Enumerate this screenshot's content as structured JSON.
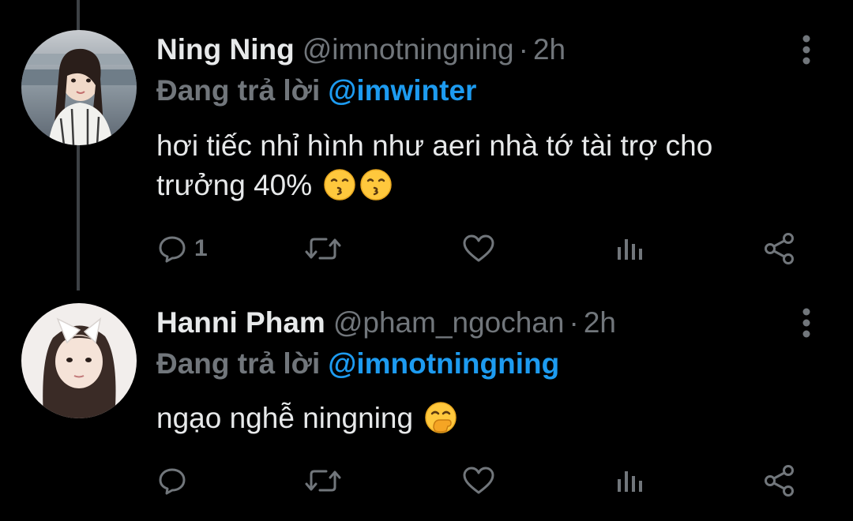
{
  "tweets": [
    {
      "name": "Ning Ning",
      "handle": "@imnotningning",
      "separator": "·",
      "time": "2h",
      "reply_prefix": "Đang trả lời",
      "reply_target": "@imwinter",
      "text_line_1": "hơi tiếc nhỉ hình như aeri nhà tớ tài trợ cho",
      "text_line_2": "trưởng 40%",
      "emojis": [
        "kissing-face",
        "kissing-face"
      ],
      "reply_count": "1"
    },
    {
      "name": "Hanni Pham",
      "handle": "@pham_ngochan",
      "separator": "·",
      "time": "2h",
      "reply_prefix": "Đang trả lời",
      "reply_target": "@imnotningning",
      "text_line_1": "ngạo nghễ ningning",
      "emojis": [
        "face-with-hand-over-mouth"
      ],
      "reply_count": ""
    }
  ],
  "icons": {
    "reply": "reply-icon",
    "retweet": "retweet-icon",
    "like": "heart-icon",
    "views": "views-icon",
    "share": "share-icon",
    "more": "more-icon"
  },
  "colors": {
    "background": "#000000",
    "text": "#e7e9ea",
    "muted": "#71767b",
    "link": "#1d9bf0",
    "thread_line": "#3d4145"
  }
}
